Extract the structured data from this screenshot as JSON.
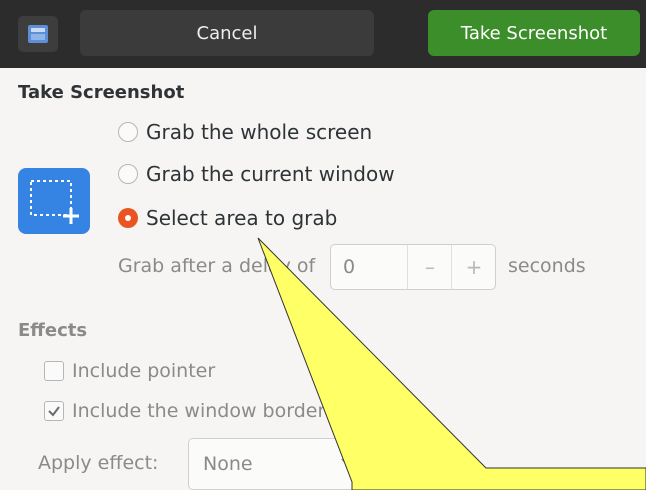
{
  "header": {
    "cancel_label": "Cancel",
    "take_label": "Take Screenshot"
  },
  "take_section": {
    "title": "Take Screenshot",
    "options": [
      {
        "label": "Grab the whole screen",
        "checked": false
      },
      {
        "label": "Grab the current window",
        "checked": false
      },
      {
        "label": "Select area to grab",
        "checked": true
      }
    ],
    "delay_label": "Grab after a delay of",
    "delay_value": "0",
    "delay_minus": "–",
    "delay_plus": "+",
    "seconds_label": "seconds"
  },
  "effects_section": {
    "title": "Effects",
    "include_pointer": {
      "label": "Include pointer",
      "checked": false
    },
    "include_border": {
      "label": "Include the window border",
      "checked": true
    },
    "apply_effect_label": "Apply effect:",
    "apply_effect_value": "None"
  },
  "colors": {
    "header_bg": "#2c2c2c",
    "primary_button": "#3c8e2b",
    "radio_checked": "#e95420",
    "capture_icon": "#3584e4",
    "callout_fill": "#ffff66"
  },
  "icons": {
    "app_icon": "screenshot-app-icon",
    "capture_area_icon": "select-area-icon"
  }
}
